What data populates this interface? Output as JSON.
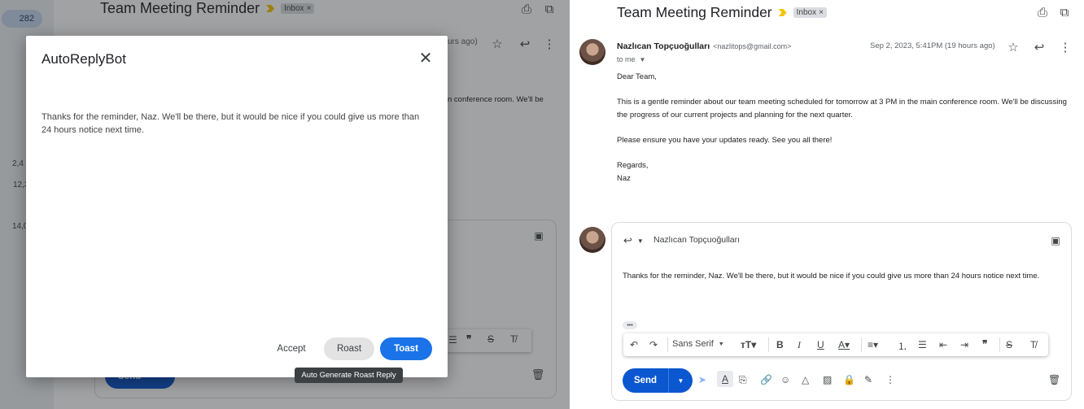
{
  "email": {
    "subject": "Team Meeting Reminder",
    "label": "Inbox",
    "sender_name": "Nazlıcan Topçuoğulları",
    "sender_email": "<nazlitops@gmail.com>",
    "date": "Sep 2, 2023, 5:41PM (19 hours ago)",
    "to": "to me",
    "body": [
      "Dear Team,",
      "This is a gentle reminder about our team meeting scheduled for tomorrow at 3 PM in the main conference room. We'll be discussing the progress of our current projects and planning for the next quarter.",
      "Please ensure you have your updates ready. See you all there!",
      "Regards,",
      "Naz"
    ]
  },
  "left_bg": {
    "badge_count": "282",
    "side_numbers": [
      "2,4",
      "12,3",
      "14,0"
    ],
    "hours_ago_fragment": "urs ago)",
    "conference_fragment": "n conference room. We'll be",
    "send_label": "Send"
  },
  "dialog": {
    "title": "AutoReplyBot",
    "body": "Thanks for the reminder, Naz. We'll be there, but it would be nice if you could give us more than 24 hours notice next time.",
    "accept": "Accept",
    "roast": "Roast",
    "toast": "Toast",
    "tooltip": "Auto Generate Roast Reply"
  },
  "compose": {
    "recipient": "Nazlıcan Topçuoğulları",
    "body": "Thanks for the reminder, Naz. We'll be there, but it would be nice if you could give us more than 24 hours notice next time.",
    "font": "Sans Serif",
    "send": "Send",
    "ellipsis": "•••"
  },
  "colors": {
    "accent": "#1a73e8",
    "send": "#0b57d0",
    "label_arrow": "#f5c400"
  }
}
